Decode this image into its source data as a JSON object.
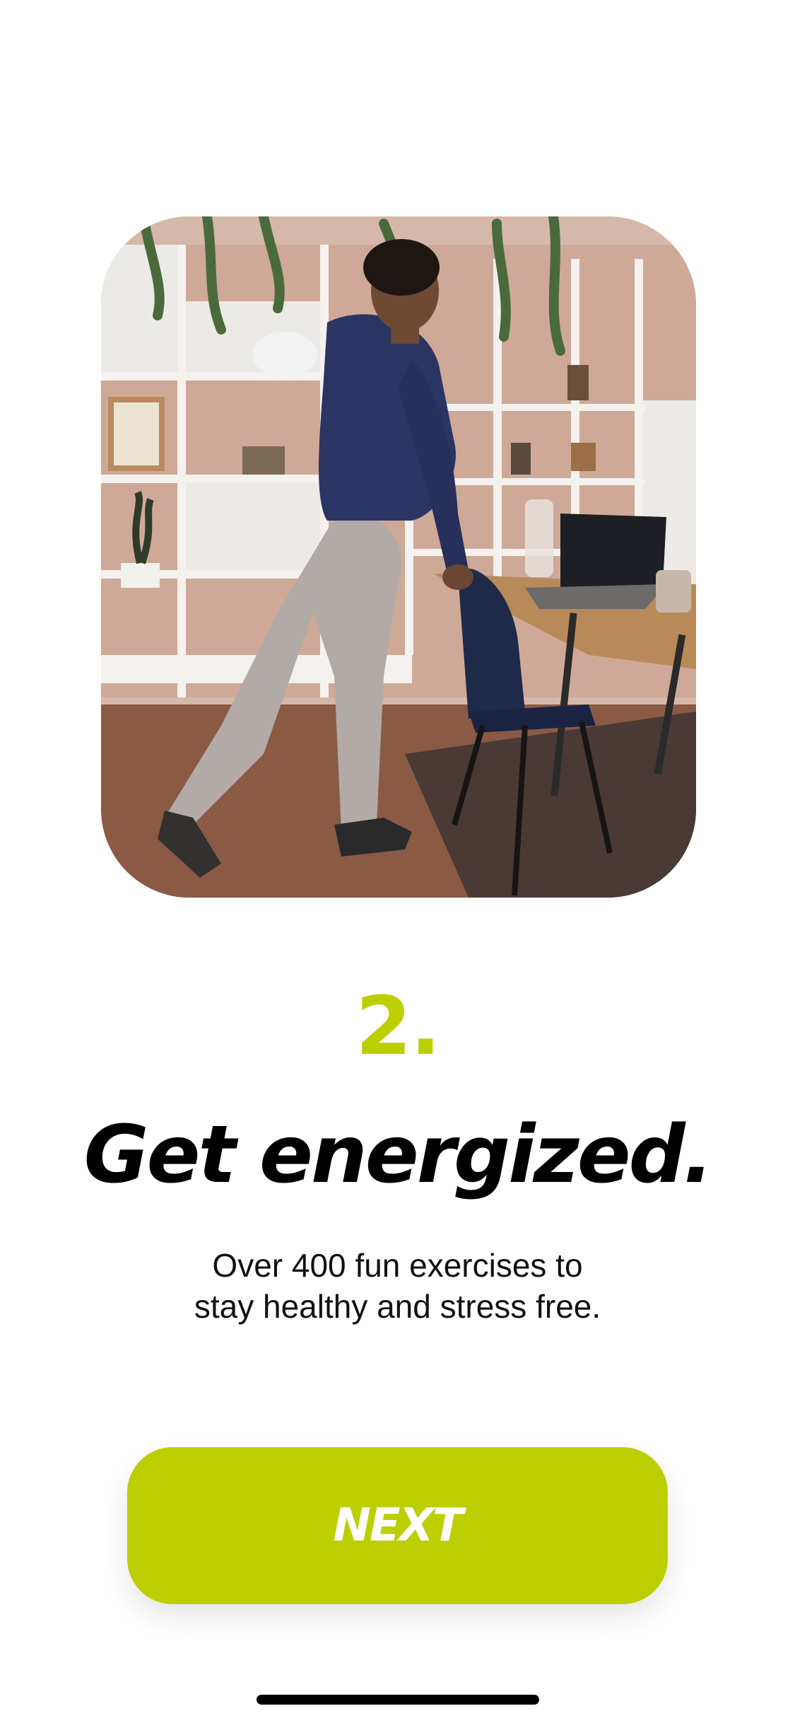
{
  "onboarding": {
    "hero_image_alt": "Man stretching leg while leaning on a chair in an office",
    "step_number": "2.",
    "headline": "Get energized.",
    "subtitle_line1": "Over 400 fun exercises to",
    "subtitle_line2": "stay healthy and stress free.",
    "next_label": "NEXT"
  },
  "colors": {
    "accent": "#bccf03",
    "text_primary": "#000000",
    "background": "#ffffff"
  }
}
